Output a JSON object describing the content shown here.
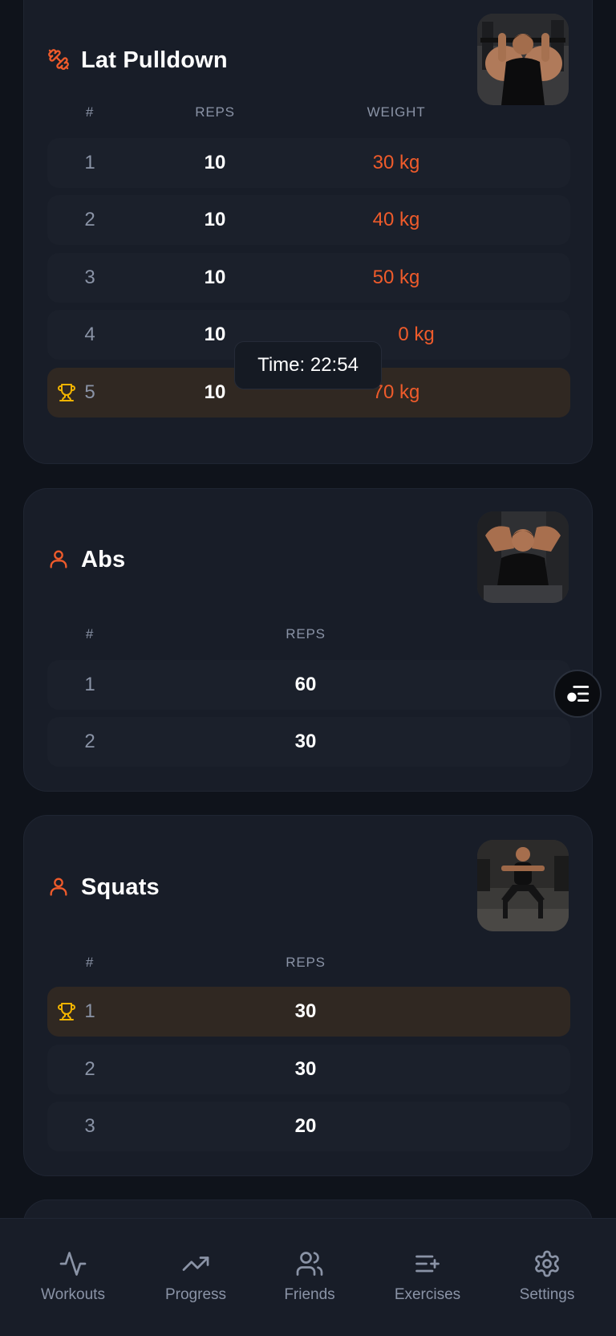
{
  "tooltip": {
    "text": "Time: 22:54"
  },
  "colors": {
    "background": "#0f131b",
    "card": "#181d28",
    "accent": "#ef5b2b",
    "trophy": "#f2b400",
    "muted": "#8a93a6",
    "best_row": "#302822"
  },
  "exercises": [
    {
      "title": "Lat Pulldown",
      "icon": "dumbbell-icon",
      "headers": {
        "number": "#",
        "reps": "REPS",
        "weight": "WEIGHT"
      },
      "sets": [
        {
          "number": "1",
          "reps": "10",
          "weight": "30 kg",
          "best": false
        },
        {
          "number": "2",
          "reps": "10",
          "weight": "40 kg",
          "best": false
        },
        {
          "number": "3",
          "reps": "10",
          "weight": "50 kg",
          "best": false
        },
        {
          "number": "4",
          "reps": "10",
          "weight": "0 kg",
          "best": false
        },
        {
          "number": "5",
          "reps": "10",
          "weight": "70 kg",
          "best": true
        }
      ]
    },
    {
      "title": "Abs",
      "icon": "person-icon",
      "headers": {
        "number": "#",
        "reps": "REPS"
      },
      "sets": [
        {
          "number": "1",
          "reps": "60",
          "best": false
        },
        {
          "number": "2",
          "reps": "30",
          "best": false
        }
      ]
    },
    {
      "title": "Squats",
      "icon": "person-icon",
      "headers": {
        "number": "#",
        "reps": "REPS"
      },
      "sets": [
        {
          "number": "1",
          "reps": "30",
          "best": true
        },
        {
          "number": "2",
          "reps": "30",
          "best": false
        },
        {
          "number": "3",
          "reps": "20",
          "best": false
        }
      ]
    }
  ],
  "nav": {
    "items": [
      {
        "label": "Workouts",
        "icon": "activity-icon"
      },
      {
        "label": "Progress",
        "icon": "trending-up-icon"
      },
      {
        "label": "Friends",
        "icon": "users-icon"
      },
      {
        "label": "Exercises",
        "icon": "list-plus-icon"
      },
      {
        "label": "Settings",
        "icon": "gear-icon"
      }
    ]
  }
}
